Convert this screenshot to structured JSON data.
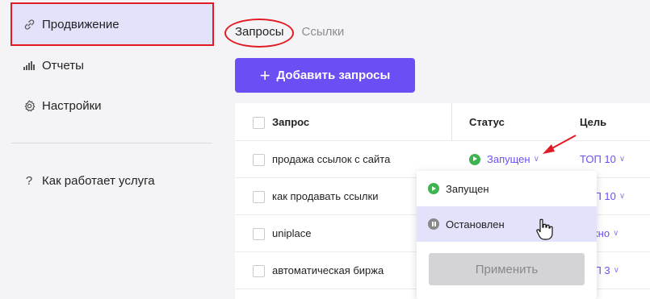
{
  "sidebar": {
    "items": [
      {
        "label": "Продвижение",
        "icon": "link-icon"
      },
      {
        "label": "Отчеты",
        "icon": "bar-chart-icon"
      },
      {
        "label": "Настройки",
        "icon": "gear-icon"
      }
    ],
    "help": {
      "label": "Как работает услуга",
      "icon": "question-icon"
    }
  },
  "tabs": [
    "Запросы",
    "Ссылки"
  ],
  "add_button": {
    "label": "Добавить запросы",
    "icon": "plus-icon"
  },
  "table": {
    "columns": [
      "Запрос",
      "Статус",
      "Цель"
    ],
    "rows": [
      {
        "query": "продажа ссылок с сайта",
        "status": "Запущен",
        "goal": "ТОП 10"
      },
      {
        "query": "как продавать ссылки",
        "status": "",
        "goal": "ТОП 10"
      },
      {
        "query": "uniplace",
        "status": "",
        "goal": "важно"
      },
      {
        "query": "автоматическая биржа",
        "status": "",
        "goal": "ТОП 3"
      }
    ]
  },
  "status_dropdown": {
    "options": [
      "Запущен",
      "Остановлен"
    ],
    "apply_label": "Применить"
  },
  "colors": {
    "accent": "#6c4ef5",
    "running": "#3fb34f",
    "highlight": "#e01b24",
    "active_bg": "#e3e2fb"
  }
}
